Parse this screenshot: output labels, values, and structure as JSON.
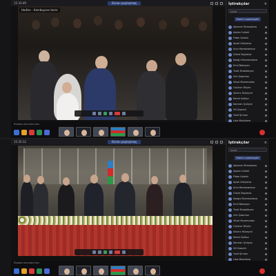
{
  "screens": [
    {
      "id": "top",
      "window_time": "15:33:49",
      "caption": "Hadise - Azerbaycan tarixi",
      "title_pill": "Ekranı paylaşmaq",
      "taskbar_label": "Raqbas Azmətov'dan",
      "participants_title": "İştirakçılar",
      "search_placeholder": "Axtar",
      "mute_all_label": "Hamını səssizləşdir",
      "participants": [
        "Aybəniz Əhmədova",
        "Aydan Cəfərli",
        "Fidan Aslanlı",
        "Aysel Zəkiyeva",
        "Arzu Ramazanova",
        "Günel Bəşirova",
        "Nərgiz Məmmədova",
        "Emil Babayev",
        "Tural Mustafayev",
        "Ülvi Qasımov",
        "Vüsal Məmmədov",
        "Ceyhun Əliyev",
        "Sevinc Hüseynli",
        "Ramil Xəlilov",
        "Kamran Quliyev",
        "Əli Qasımlı",
        "Yusif Şirinov",
        "Lalə Məcidova",
        "Nigar Səfərova",
        "Orxan Cəfərov",
        "Yusif İsmayıl"
      ]
    },
    {
      "id": "bottom",
      "window_time": "15:35:12",
      "caption": "",
      "title_pill": "Ekranı paylaşmaq",
      "taskbar_label": "Raqbas Azmətov'dan",
      "participants_title": "İştirakçılar",
      "search_placeholder": "Axtar",
      "mute_all_label": "Hamını səssizləşdir",
      "participants": [
        "Aybəniz Əhmədova",
        "Aydan Cəfərli",
        "Fidan Aslanlı",
        "Aysel Zəkiyeva",
        "Arzu Ramazanova",
        "Günel Bəşirova",
        "Nərgiz Məmmədova",
        "Emil Babayev",
        "Tural Mustafayev",
        "Ülvi Qasımov",
        "Vüsal Məmmədov",
        "Ceyhun Əliyev",
        "Sevinc Hüseynli",
        "Ramil Xəlilov",
        "Kamran Quliyev",
        "Əli Qasımlı",
        "Yusif Şirinov",
        "Lalə Məcidova",
        "Nigar Səfərova",
        "Orxan Cəfərov",
        "Yusif İsmayıl"
      ]
    }
  ],
  "icons": {
    "close": "close-icon",
    "mic": "mic-icon",
    "camera": "camera-icon",
    "share": "share-screen-icon",
    "hangup": "hangup-icon"
  },
  "colors": {
    "accent": "#2e3b66",
    "hangup": "#d23030",
    "panel_bg": "#18181b",
    "topbar": "#1b1b1f"
  }
}
